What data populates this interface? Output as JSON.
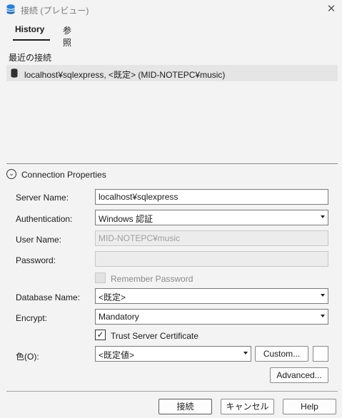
{
  "window": {
    "title": "接続 (プレビュー)",
    "close_glyph": "✕"
  },
  "tabs": [
    {
      "label": "History",
      "active": true
    },
    {
      "label": "参照",
      "active": false
    }
  ],
  "recent": {
    "title": "最近の接続",
    "items": [
      {
        "label": "localhost¥sqlexpress, <既定> (MID-NOTEPC¥music)",
        "icon": "database-icon"
      }
    ]
  },
  "connection_properties": {
    "title": "Connection Properties",
    "toggle_glyph": "⌄",
    "server_name": {
      "label": "Server Name:",
      "value": "localhost¥sqlexpress"
    },
    "authentication": {
      "label": "Authentication:",
      "value": "Windows 認証"
    },
    "user_name": {
      "label": "User Name:",
      "value": "MID-NOTEPC¥music"
    },
    "password": {
      "label": "Password:",
      "value": ""
    },
    "remember_password": {
      "label": "Remember Password",
      "checked": false
    },
    "database_name": {
      "label": "Database Name:",
      "value": "<既定>"
    },
    "encrypt": {
      "label": "Encrypt:",
      "value": "Mandatory"
    },
    "trust_server_certificate": {
      "label": "Trust Server Certificate",
      "checked": true,
      "check_glyph": "✓"
    },
    "color": {
      "label": "色(O):",
      "value": "<既定値>",
      "custom_label": "Custom..."
    },
    "advanced_label": "Advanced..."
  },
  "footer": {
    "connect": "接続",
    "cancel": "キャンセル",
    "help": "Help"
  },
  "colors": {
    "accent": "#0067c0",
    "db_icon": "#2f2f2f",
    "selected_row": "#e5e5e5"
  }
}
